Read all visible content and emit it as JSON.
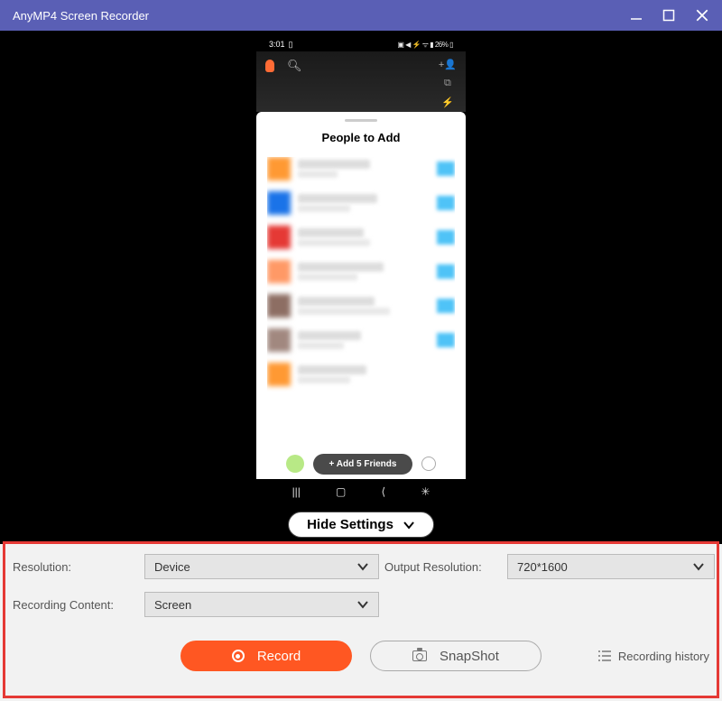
{
  "titlebar": {
    "title": "AnyMP4 Screen Recorder"
  },
  "phone": {
    "status": {
      "time": "3:01",
      "indicators": "▣ ◀ ⚡ ᯤ ▮ 26% ▯"
    },
    "heading": "People to Add",
    "add_friends_label": "+ Add 5 Friends"
  },
  "hide_settings": {
    "label": "Hide Settings"
  },
  "settings": {
    "resolution_label": "Resolution:",
    "resolution_value": "Device",
    "output_label": "Output Resolution:",
    "output_value": "720*1600",
    "content_label": "Recording Content:",
    "content_value": "Screen"
  },
  "actions": {
    "record_label": "Record",
    "snapshot_label": "SnapShot",
    "history_label": "Recording history"
  }
}
